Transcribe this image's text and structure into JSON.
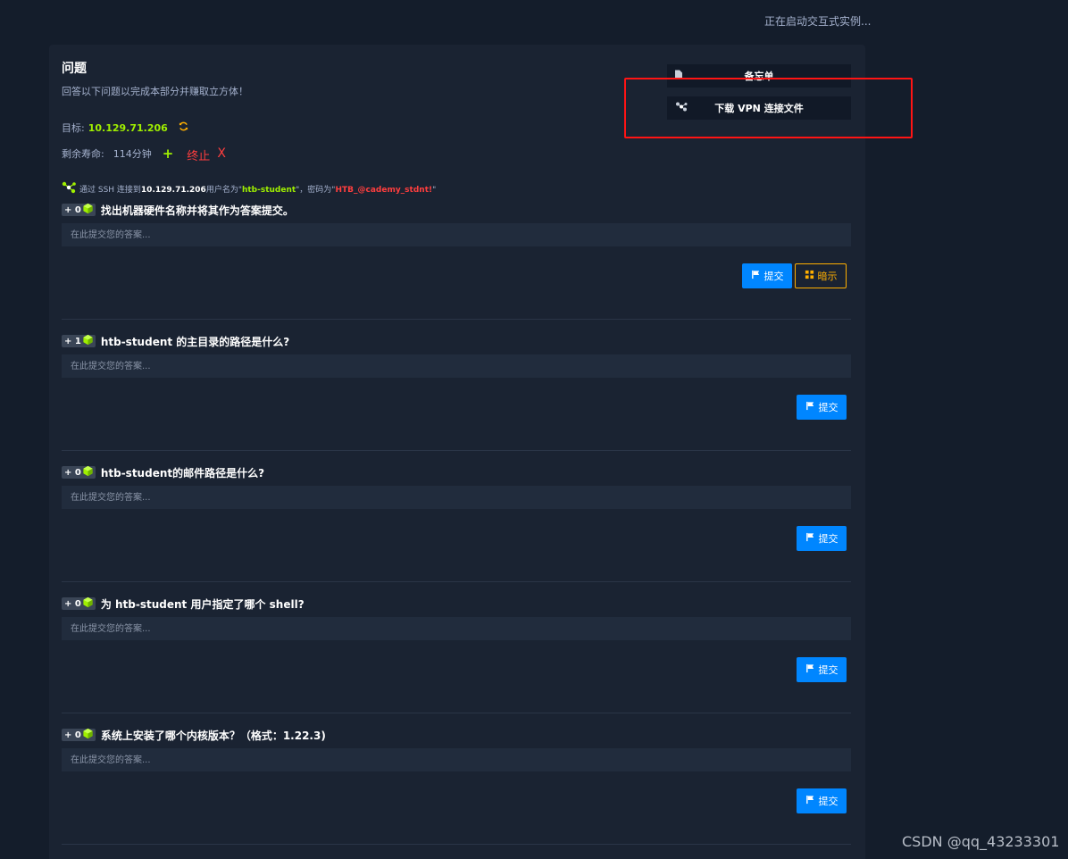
{
  "status_text": "正在启动交互式实例...",
  "section": {
    "title": "问题",
    "subtitle": "回答以下问题以完成本部分并赚取立方体！",
    "target_label": "目标:",
    "target_ip": "10.129.71.206",
    "life_label": "剩余寿命:",
    "life_value": "114分钟",
    "terminate_label": "终止",
    "terminate_x": "X"
  },
  "side_buttons": {
    "notes_label": "备忘单",
    "vpn_label": "下载 VPN 连接文件"
  },
  "ssh_note": {
    "prefix": "通过 SSH 连接到",
    "ip": "10.129.71.206",
    "user_prefix": "用户名为\"",
    "user": "htb-student",
    "pass_prefix": "\"，密码为\"",
    "pass": "HTB_@cademy_stdnt!",
    "suffix": "\""
  },
  "questions": [
    {
      "reward": "+ 0",
      "text": "找出机器硬件名称并将其作为答案提交。",
      "placeholder": "在此提交您的答案...",
      "submit": "提交",
      "hint": "暗示"
    },
    {
      "reward": "+ 1",
      "text": "htb-student 的主目录的路径是什么?",
      "placeholder": "在此提交您的答案...",
      "submit": "提交"
    },
    {
      "reward": "+ 0",
      "text": "htb-student的邮件路径是什么?",
      "placeholder": "在此提交您的答案...",
      "submit": "提交"
    },
    {
      "reward": "+ 0",
      "text": "为 htb-student 用户指定了哪个 shell?",
      "placeholder": "在此提交您的答案...",
      "submit": "提交"
    },
    {
      "reward": "+ 0",
      "text": "系统上安装了哪个内核版本？（格式：1.22.3)",
      "placeholder": "在此提交您的答案...",
      "submit": "提交"
    }
  ],
  "watermark": "CSDN @qq_43233301",
  "colors": {
    "background": "#141d2b",
    "panel": "#1a2332",
    "accent_green": "#9fef00",
    "accent_blue": "#0086ff",
    "accent_orange": "#ffaf00",
    "danger_red": "#ff3e3e"
  },
  "icons": [
    "refresh-icon",
    "plus-icon",
    "document-icon",
    "network-icon",
    "cube-icon",
    "flag-icon",
    "hint-icon"
  ]
}
